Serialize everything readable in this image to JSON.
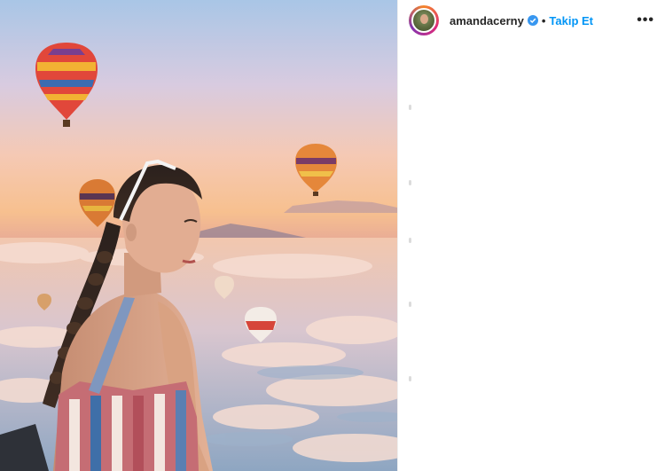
{
  "post": {
    "image_alt": "Woman with braided hair and sunglasses on head looking over a sea of clouds at sunset with hot air balloons",
    "author": {
      "username": "amandacerny",
      "verified": true,
      "separator": "•",
      "follow_label": "Takip Et",
      "more_label": "•••"
    },
    "icons": [
      "avatar",
      "verified-badge-icon",
      "more-options-icon"
    ]
  },
  "colors": {
    "follow_blue": "#0095f6",
    "username_text": "#262626",
    "verified_blue": "#3897f0"
  }
}
